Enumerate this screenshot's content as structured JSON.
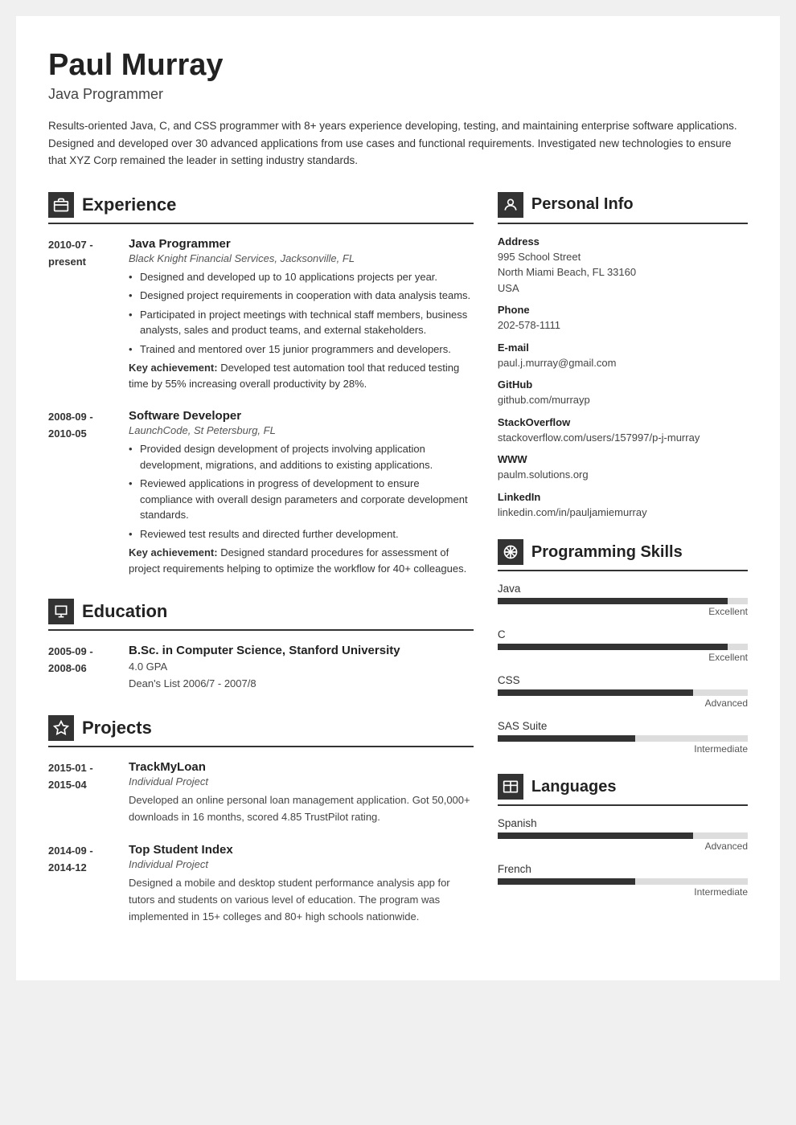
{
  "header": {
    "name": "Paul Murray",
    "title": "Java Programmer",
    "summary": "Results-oriented Java, C, and CSS programmer with 8+ years experience developing, testing, and maintaining enterprise software applications. Designed and developed over 30 advanced applications from use cases and functional requirements. Investigated new technologies to ensure that XYZ Corp remained the leader in setting industry standards."
  },
  "experience": {
    "section_title": "Experience",
    "entries": [
      {
        "date_start": "2010-07 -",
        "date_end": "present",
        "title": "Java Programmer",
        "subtitle": "Black Knight Financial Services, Jacksonville, FL",
        "bullets": [
          "Designed and developed up to 10 applications projects per year.",
          "Designed project requirements in cooperation with data analysis teams.",
          "Participated in project meetings with technical staff members, business analysts, sales and product teams, and external stakeholders.",
          "Trained and mentored over 15 junior programmers and developers."
        ],
        "achievement": "Developed test automation tool that reduced testing time by 55% increasing overall productivity by 28%."
      },
      {
        "date_start": "2008-09 -",
        "date_end": "2010-05",
        "title": "Software Developer",
        "subtitle": "LaunchCode, St Petersburg, FL",
        "bullets": [
          "Provided design development of projects involving application development, migrations, and additions to existing applications.",
          "Reviewed applications in progress of development to ensure compliance with overall design parameters and corporate development standards.",
          "Reviewed test results and directed further development."
        ],
        "achievement": "Designed standard procedures for assessment of project requirements helping to optimize the workflow for 40+ colleagues."
      }
    ]
  },
  "education": {
    "section_title": "Education",
    "entries": [
      {
        "date_start": "2005-09 -",
        "date_end": "2008-06",
        "title": "B.Sc. in Computer Science, Stanford University",
        "gpa": "4.0 GPA",
        "extra": "Dean's List 2006/7 - 2007/8"
      }
    ]
  },
  "projects": {
    "section_title": "Projects",
    "entries": [
      {
        "date_start": "2015-01 -",
        "date_end": "2015-04",
        "title": "TrackMyLoan",
        "subtitle": "Individual Project",
        "description": "Developed an online personal loan management application. Got 50,000+ downloads in 16 months, scored 4.85 TrustPilot rating."
      },
      {
        "date_start": "2014-09 -",
        "date_end": "2014-12",
        "title": "Top Student Index",
        "subtitle": "Individual Project",
        "description": "Designed a mobile and desktop student performance analysis app for tutors and students on various level of education. The program was implemented in 15+ colleges and 80+ high schools nationwide."
      }
    ]
  },
  "personal_info": {
    "section_title": "Personal Info",
    "fields": [
      {
        "label": "Address",
        "value": "995 School Street\nNorth Miami Beach, FL 33160\nUSA"
      },
      {
        "label": "Phone",
        "value": "202-578-1111"
      },
      {
        "label": "E-mail",
        "value": "paul.j.murray@gmail.com"
      },
      {
        "label": "GitHub",
        "value": "github.com/murrayp"
      },
      {
        "label": "StackOverflow",
        "value": "stackoverflow.com/users/157997/p-j-murray"
      },
      {
        "label": "WWW",
        "value": "paulm.solutions.org"
      },
      {
        "label": "LinkedIn",
        "value": "linkedin.com/in/pauljamiemurray"
      }
    ]
  },
  "programming_skills": {
    "section_title": "Programming Skills",
    "skills": [
      {
        "name": "Java",
        "level": "Excellent",
        "percent": 92
      },
      {
        "name": "C",
        "level": "Excellent",
        "percent": 92
      },
      {
        "name": "CSS",
        "level": "Advanced",
        "percent": 78
      },
      {
        "name": "SAS Suite",
        "level": "Intermediate",
        "percent": 55
      }
    ]
  },
  "languages": {
    "section_title": "Languages",
    "items": [
      {
        "name": "Spanish",
        "level": "Advanced",
        "percent": 78
      },
      {
        "name": "French",
        "level": "Intermediate",
        "percent": 55
      }
    ]
  },
  "icons": {
    "experience": "💼",
    "education": "🎓",
    "projects": "⭐",
    "personal_info": "👤",
    "programming_skills": "⚙️",
    "languages": "🏳️"
  }
}
